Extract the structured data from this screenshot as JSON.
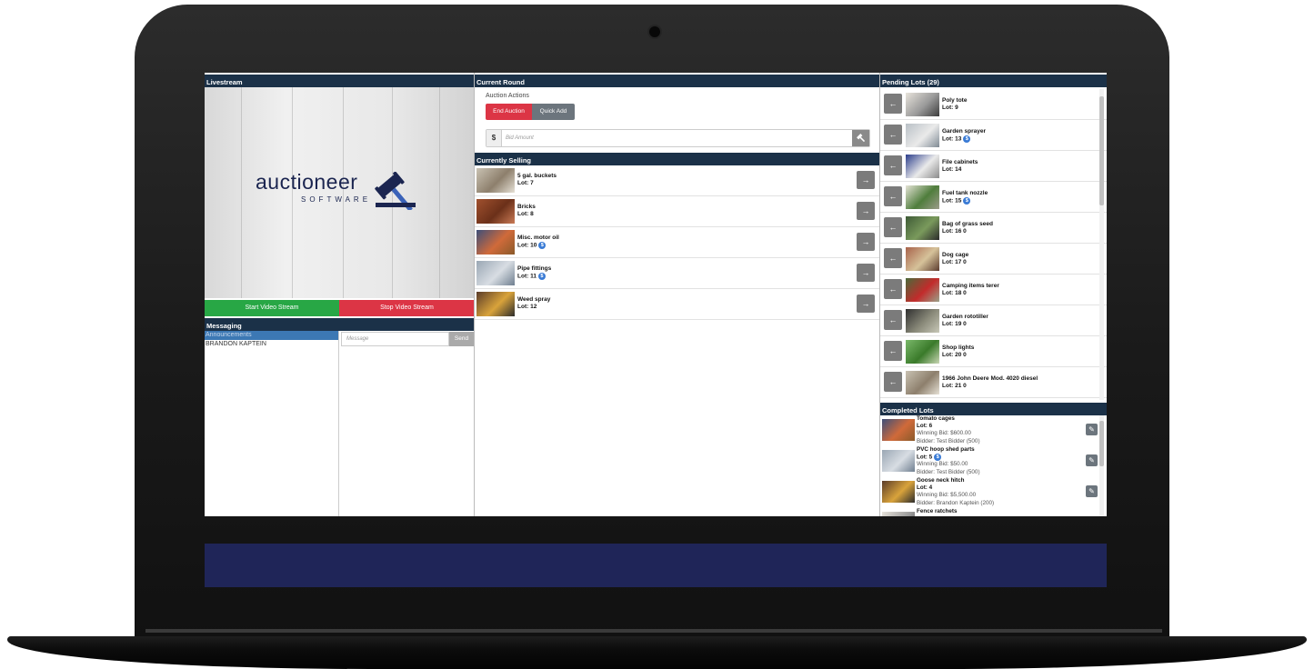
{
  "livestream": {
    "header": "Livestream",
    "logo_word": "auctioneer",
    "logo_sub": "SOFTWARE",
    "start_button": "Start Video Stream",
    "stop_button": "Stop Video Stream"
  },
  "messaging": {
    "header": "Messaging",
    "threads": [
      "Announcements",
      "BRANDON KAPTEIN"
    ],
    "selected_index": 0,
    "input_placeholder": "Message",
    "send_button": "Send"
  },
  "current_round": {
    "header": "Current Round",
    "actions_label": "Auction Actions",
    "end_button": "End Auction",
    "quick_add_button": "Quick Add",
    "currency": "$",
    "bid_placeholder": "Bid Amount",
    "bid_icon": "gavel-icon"
  },
  "currently_selling": {
    "header": "Currently Selling",
    "items": [
      {
        "name": "5 gal. buckets",
        "lot": "Lot: 7",
        "badge": ""
      },
      {
        "name": "Bricks",
        "lot": "Lot: 8",
        "badge": ""
      },
      {
        "name": "Misc. motor oil",
        "lot": "Lot: 10",
        "badge": "$"
      },
      {
        "name": "Pipe fittings",
        "lot": "Lot: 11",
        "badge": "$"
      },
      {
        "name": "Weed spray",
        "lot": "Lot: 12",
        "badge": ""
      }
    ]
  },
  "pending_lots": {
    "header": "Pending Lots (29)",
    "items": [
      {
        "name": "Poly tote",
        "lot": "Lot: 9",
        "badge": ""
      },
      {
        "name": "Garden sprayer",
        "lot": "Lot: 13",
        "badge": "$"
      },
      {
        "name": "File cabinets",
        "lot": "Lot: 14",
        "badge": ""
      },
      {
        "name": "Fuel tank nozzle",
        "lot": "Lot: 15",
        "badge": "$"
      },
      {
        "name": "Bag of grass seed",
        "lot": "Lot: 16 0",
        "badge": ""
      },
      {
        "name": "Dog cage",
        "lot": "Lot: 17 0",
        "badge": ""
      },
      {
        "name": "Camping items terer",
        "lot": "Lot: 18 0",
        "badge": ""
      },
      {
        "name": "Garden rototiller",
        "lot": "Lot: 19 0",
        "badge": ""
      },
      {
        "name": "Shop lights",
        "lot": "Lot: 20 0",
        "badge": ""
      },
      {
        "name": "1966 John Deere Mod. 4020 diesel",
        "lot": "Lot: 21 0",
        "badge": ""
      }
    ]
  },
  "completed_lots": {
    "header": "Completed Lots",
    "items": [
      {
        "name": "Tomato cages",
        "lot": "Lot: 6",
        "badge": "",
        "winning": "Winning Bid: $600.00",
        "bidder": "Bidder: Test Bidder (500)"
      },
      {
        "name": "PVC hoop shed parts",
        "lot": "Lot: 5",
        "badge": "$",
        "winning": "Winning Bid: $50.00",
        "bidder": "Bidder: Test Bidder (500)"
      },
      {
        "name": "Goose neck hitch",
        "lot": "Lot: 4",
        "badge": "",
        "winning": "Winning Bid: $5,500.00",
        "bidder": "Bidder: Brandon Kaptein (200)"
      },
      {
        "name": "Fence ratchets",
        "lot": "",
        "badge": "",
        "winning": "",
        "bidder": ""
      }
    ]
  },
  "colors": {
    "header_bg": "#1b3148",
    "start_green": "#28a745",
    "stop_red": "#dc3545",
    "navy_bar": "#1f2558",
    "badge_blue": "#3a7bd5"
  }
}
